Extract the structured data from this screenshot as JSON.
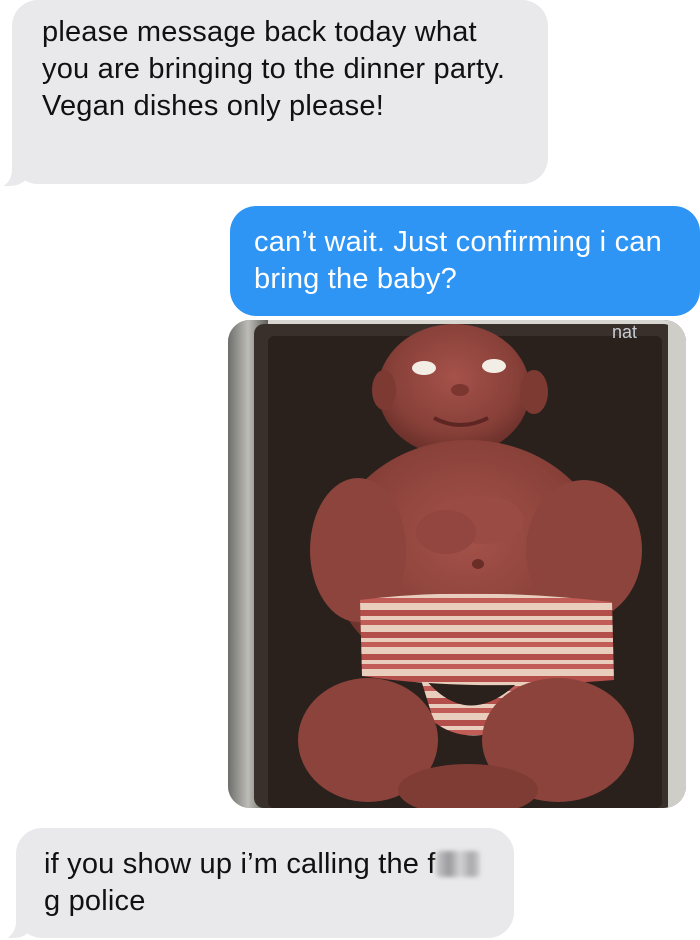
{
  "messages": [
    {
      "direction": "incoming",
      "text": "please message back today what you are bringing to the dinner party. Vegan dishes only please!"
    },
    {
      "direction": "outgoing",
      "text": "can’t wait. Just confirming i can bring the baby?"
    },
    {
      "direction": "outgoing",
      "type": "photo",
      "subject": "raw-meat-baby-with-bacon-diaper"
    },
    {
      "direction": "incoming",
      "text_before": "if you show up i’m calling the f",
      "text_after": "g police"
    }
  ],
  "colors": {
    "incoming_bubble": "#e9e9eb",
    "outgoing_bubble": "#2e95f5",
    "incoming_text": "#111111",
    "outgoing_text": "#ffffff",
    "background": "#ffffff"
  }
}
